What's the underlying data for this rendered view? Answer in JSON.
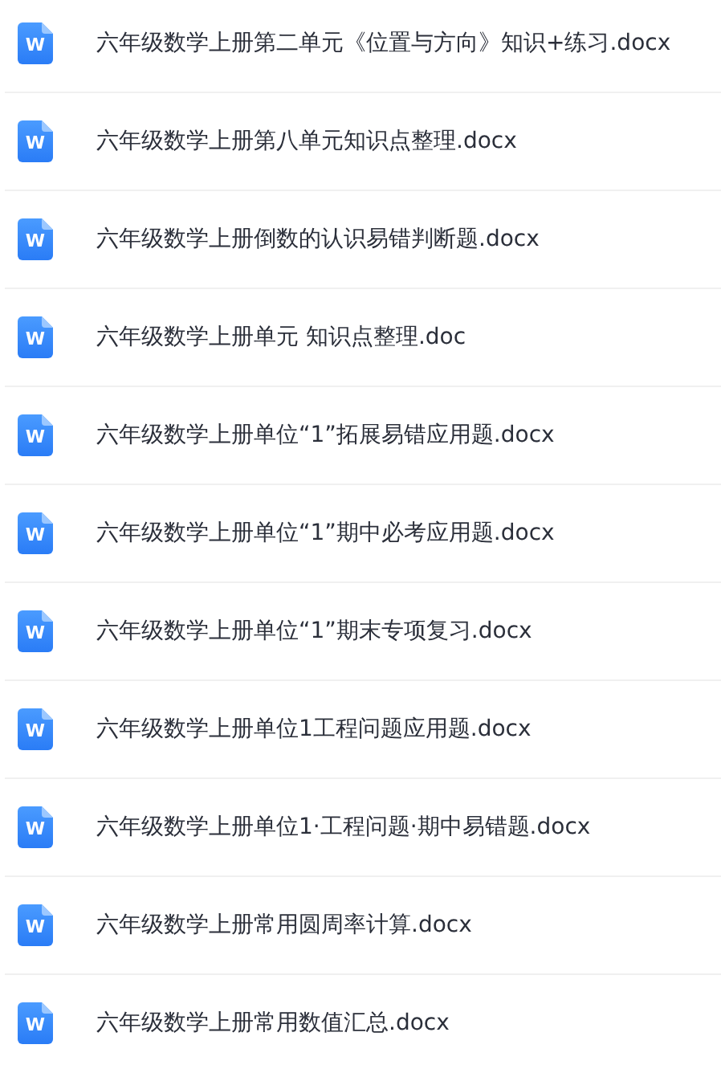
{
  "files": [
    {
      "icon_label": "W",
      "name": "六年级数学上册第二单元《位置与方向》知识+练习.docx"
    },
    {
      "icon_label": "W",
      "name": "六年级数学上册第八单元知识点整理.docx"
    },
    {
      "icon_label": "W",
      "name": "六年级数学上册倒数的认识易错判断题.docx"
    },
    {
      "icon_label": "W",
      "name": "六年级数学上册单元 知识点整理.doc"
    },
    {
      "icon_label": "W",
      "name": "六年级数学上册单位“1”拓展易错应用题.docx"
    },
    {
      "icon_label": "W",
      "name": "六年级数学上册单位“1”期中必考应用题.docx"
    },
    {
      "icon_label": "W",
      "name": "六年级数学上册单位“1”期末专项复习.docx"
    },
    {
      "icon_label": "W",
      "name": "六年级数学上册单位1工程问题应用题.docx"
    },
    {
      "icon_label": "W",
      "name": "六年级数学上册单位1·工程问题·期中易错题.docx"
    },
    {
      "icon_label": "W",
      "name": "六年级数学上册常用圆周率计算.docx"
    },
    {
      "icon_label": "W",
      "name": "六年级数学上册常用数值汇总.docx"
    }
  ]
}
